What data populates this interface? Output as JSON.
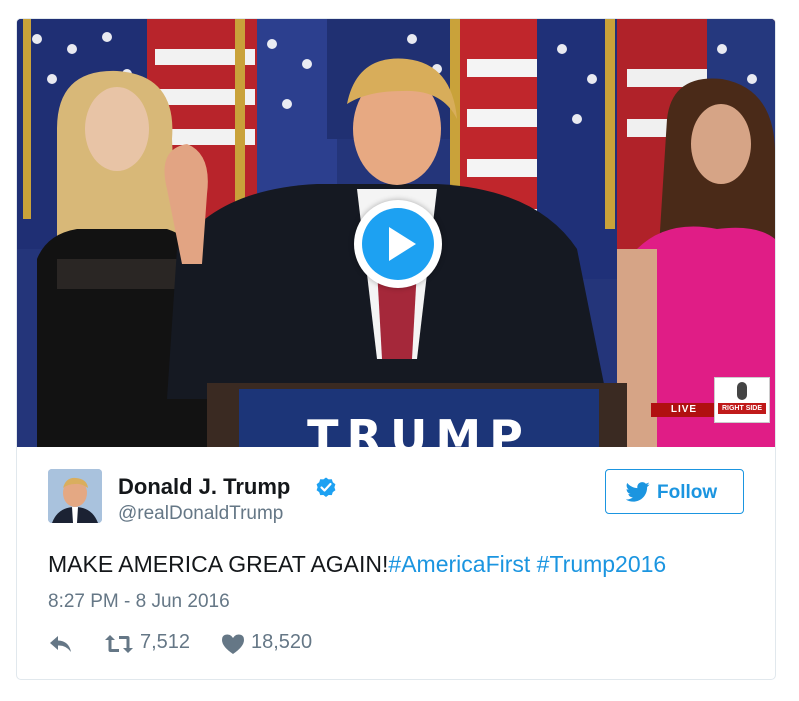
{
  "media": {
    "podium_text": "TRUMP",
    "live_badge": "LIVE",
    "logo_text": "RIGHT SIDE"
  },
  "tweet": {
    "author_name": "Donald J. Trump",
    "author_handle": "@realDonaldTrump",
    "follow_label": "Follow",
    "text_main": "MAKE AMERICA GREAT AGAIN!",
    "hashtags": [
      "#AmericaFirst",
      "#Trump2016"
    ],
    "timestamp": "8:27 PM - 8 Jun 2016",
    "retweets": "7,512",
    "likes": "18,520"
  },
  "icons": {
    "verified": "verified-badge-icon",
    "play": "play-icon",
    "follow": "twitter-bird-icon",
    "reply": "reply-icon",
    "retweet": "retweet-icon",
    "like": "heart-icon"
  },
  "colors": {
    "brand_blue": "#1da1f2",
    "link_blue": "#1b95e0",
    "muted_gray": "#657786",
    "text": "#14171a",
    "border": "#e1e8ed"
  }
}
